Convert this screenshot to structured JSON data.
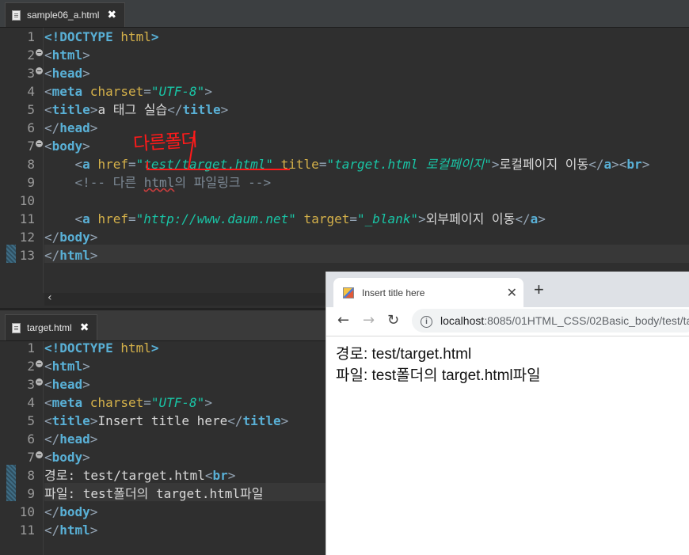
{
  "editor1": {
    "tab_label": "sample06_a.html",
    "close_icon": "✖",
    "active_line": "13",
    "lines": [
      {
        "n": "1",
        "fold": false
      },
      {
        "n": "2",
        "fold": true
      },
      {
        "n": "3",
        "fold": true
      },
      {
        "n": "4",
        "fold": false
      },
      {
        "n": "5",
        "fold": false
      },
      {
        "n": "6",
        "fold": false
      },
      {
        "n": "7",
        "fold": true
      },
      {
        "n": "8",
        "fold": false
      },
      {
        "n": "9",
        "fold": false
      },
      {
        "n": "10",
        "fold": false
      },
      {
        "n": "11",
        "fold": false
      },
      {
        "n": "12",
        "fold": false
      },
      {
        "n": "13",
        "fold": false
      }
    ],
    "code": {
      "l1_doctype": "<!DOCTYPE",
      "l1_html": " html",
      "l1_end": ">",
      "html_tag": "html",
      "head_tag": "head",
      "meta_tag": "meta",
      "charset_attr": " charset",
      "charset_val": "\"UTF-8\"",
      "title_tag": "title",
      "title_text": "a 태그 실습",
      "body_tag": "body",
      "a_tag": "a",
      "href_attr": " href",
      "href_val_1": "\"test/target.html\"",
      "title_attr": " title",
      "title_val": "\"target.html 로컬페이지\"",
      "link_text_1": "로컬페이지 이동",
      "br_tag": "br",
      "comment_1": "<!-- 다른 ",
      "comment_html": "html",
      "comment_2": "의 파일링크 -->",
      "href_val_2": "\"http://www.daum.net\"",
      "target_attr": " target",
      "target_val": "\"_blank\"",
      "link_text_2": "외부페이지 이동"
    },
    "annotation": "다른폴더",
    "scroll_left_icon": "‹"
  },
  "editor2": {
    "tab_label": "target.html",
    "close_icon": "✖",
    "lines": [
      {
        "n": "1",
        "fold": false
      },
      {
        "n": "2",
        "fold": true
      },
      {
        "n": "3",
        "fold": true
      },
      {
        "n": "4",
        "fold": false
      },
      {
        "n": "5",
        "fold": false
      },
      {
        "n": "6",
        "fold": false
      },
      {
        "n": "7",
        "fold": true
      },
      {
        "n": "8",
        "fold": false
      },
      {
        "n": "9",
        "fold": false
      },
      {
        "n": "10",
        "fold": false
      },
      {
        "n": "11",
        "fold": false
      }
    ],
    "code": {
      "title_text": "Insert title here",
      "body_line_1": "경로: test/target.html",
      "body_line_2": "파일: test폴더의 target.html파일"
    }
  },
  "browser": {
    "tab_title": "Insert title here",
    "tab_close": "✕",
    "new_tab": "+",
    "back_icon": "←",
    "forward_icon": "→",
    "reload_icon": "↻",
    "info_icon": "i",
    "url_host": "localhost",
    "url_rest": ":8085/01HTML_CSS/02Basic_body/test/ta",
    "content_line_1": "경로: test/target.html",
    "content_line_2": "파일: test폴더의 target.html파일"
  }
}
